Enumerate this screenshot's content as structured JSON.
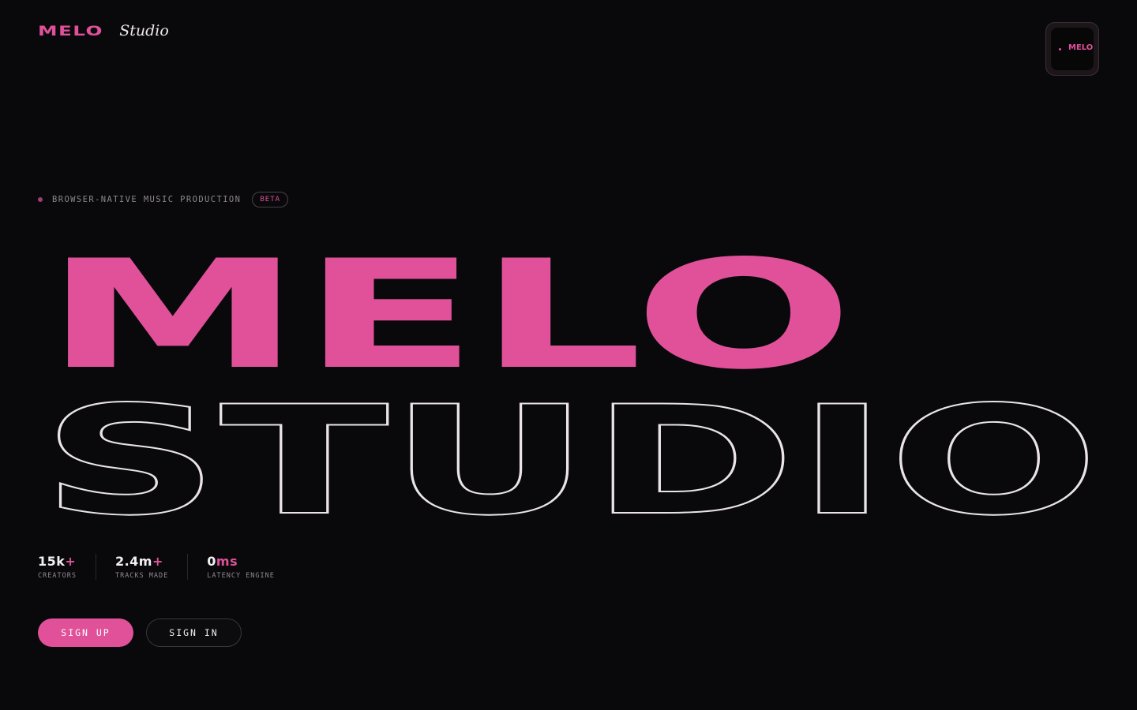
{
  "colors": {
    "background": "#09090b",
    "accent": "#e0519a",
    "text": "#f4eff2",
    "muted": "#8d8690",
    "outline_stroke": "#eae4e8"
  },
  "header": {
    "logo_word": "MELO",
    "logo_script": "Studio",
    "preview_text": "MELO"
  },
  "eyebrow": {
    "dot_icon": "status-dot",
    "text": "BROWSER-NATIVE MUSIC PRODUCTION",
    "badge": "BETA"
  },
  "hero": {
    "line1": "MELO",
    "line2": "STUDIO"
  },
  "stats": [
    {
      "value": "15k",
      "suffix": "+",
      "label": "CREATORS"
    },
    {
      "value": "2.4m",
      "suffix": "+",
      "label": "TRACKS MADE"
    },
    {
      "value": "0",
      "suffix": "ms",
      "label": "LATENCY ENGINE"
    }
  ],
  "actions": {
    "signup": "SIGN UP",
    "signin": "SIGN IN"
  }
}
